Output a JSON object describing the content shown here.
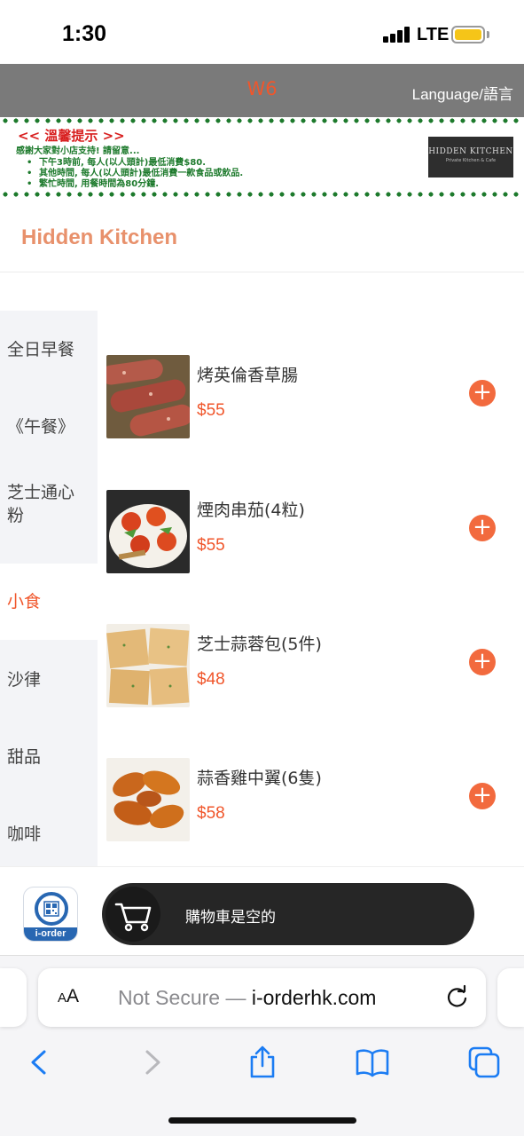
{
  "status_bar": {
    "time": "1:30",
    "network": "LTE"
  },
  "header": {
    "table_id": "W6",
    "language_label": "Language/語言"
  },
  "notice": {
    "title": "<< 溫馨提示 >>",
    "intro": "感謝大家對小店支持! 請留意...",
    "lines": [
      "下午3時前, 每人(以人頭計)最低消費$80.",
      "其他時間, 每人(以人頭計)最低消費一款食品或飲品.",
      "繁忙時間, 用餐時間為80分鐘."
    ],
    "logo_title": "HIDDEN KITCHEN",
    "logo_subtitle": "Private Kitchen & Cafe"
  },
  "shop": {
    "name": "Hidden Kitchen"
  },
  "categories": [
    {
      "label": "全日早餐"
    },
    {
      "label": "《午餐》"
    },
    {
      "label": "芝士通心粉"
    },
    {
      "label": "小食",
      "active": true
    },
    {
      "label": "沙律"
    },
    {
      "label": "甜品"
    },
    {
      "label": "咖啡"
    }
  ],
  "items": [
    {
      "name": "烤英倫香草腸",
      "price": "$55",
      "image": "sausage-photo"
    },
    {
      "name": "煙肉串茄(4粒)",
      "price": "$55",
      "image": "bacon-tomato-photo"
    },
    {
      "name": "芝士蒜蓉包(5件)",
      "price": "$48",
      "image": "garlic-bread-photo"
    },
    {
      "name": "蒜香雞中翼(6隻)",
      "price": "$58",
      "image": "chicken-wings-photo"
    }
  ],
  "add_button_label": "+",
  "cart": {
    "status": "購物車是空的",
    "app_badge": "i-order"
  },
  "browser": {
    "aa_label_small": "A",
    "aa_label_big": "A",
    "security": "Not Secure — ",
    "host": "i-orderhk.com"
  },
  "colors": {
    "accent": "#f0562b",
    "header_bg": "#7a7a7a",
    "notice_green": "#1d7a2c",
    "notice_red": "#d81f1f",
    "shop_title": "#e8916c"
  },
  "icons": [
    "signal-icon",
    "battery-icon",
    "cart-icon",
    "reload-icon",
    "back-icon",
    "forward-icon",
    "share-icon",
    "bookmarks-icon",
    "tabs-icon"
  ]
}
